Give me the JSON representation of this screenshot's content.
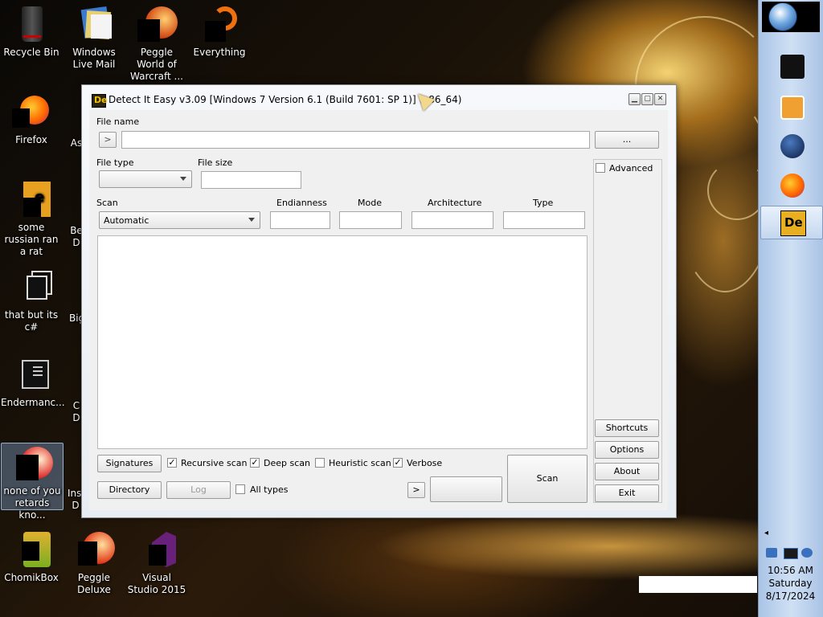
{
  "desktop": {
    "icons": [
      {
        "label": "Recycle Bin"
      },
      {
        "label": "Windows Live Mail"
      },
      {
        "label": "Peggle World of Warcraft ..."
      },
      {
        "label": "Everything"
      },
      {
        "label": "Firefox"
      },
      {
        "label": "As"
      },
      {
        "label": "some russian ran a rat"
      },
      {
        "label": "Be D"
      },
      {
        "label": "that but its c#"
      },
      {
        "label": "Big"
      },
      {
        "label": "Endermanc..."
      },
      {
        "label": "C D"
      },
      {
        "label": "none of you retards kno..."
      },
      {
        "label": "Insa D"
      },
      {
        "label": "ChomikBox"
      },
      {
        "label": "Peggle Deluxe"
      },
      {
        "label": "Visual Studio 2015"
      }
    ]
  },
  "window": {
    "title": "Detect It Easy v3.09 [Windows 7 Version 6.1 (Build 7601: SP 1)] (x86_64)",
    "icon_text": "De",
    "file_name_label": "File name",
    "file_name_value": "",
    "open_arrow": ">",
    "browse_label": "...",
    "file_type_label": "File type",
    "file_type_value": "",
    "file_size_label": "File size",
    "file_size_value": "",
    "advanced_label": "Advanced",
    "scan_label": "Scan",
    "scan_value": "Automatic",
    "endianness_label": "Endianness",
    "mode_label": "Mode",
    "architecture_label": "Architecture",
    "type_label": "Type",
    "shortcuts_label": "Shortcuts",
    "options_label": "Options",
    "about_label": "About",
    "exit_label": "Exit",
    "signatures_label": "Signatures",
    "recursive_scan_label": "Recursive scan",
    "deep_scan_label": "Deep scan",
    "heuristic_scan_label": "Heuristic scan",
    "verbose_label": "Verbose",
    "directory_label": "Directory",
    "log_label": "Log",
    "all_types_label": "All types",
    "more_arrow": ">",
    "scan_button_label": "Scan",
    "checks": {
      "recursive": true,
      "deep": true,
      "heuristic": false,
      "verbose": true,
      "all_types": false,
      "advanced": false
    },
    "check_mark": "✓"
  },
  "tray": {
    "time": "10:56 AM",
    "day": "Saturday",
    "date": "8/17/2024",
    "expand_arrow": "◂"
  },
  "colors": {
    "accent_dock": "#aac4e6",
    "de_logo": "#f2c000"
  }
}
